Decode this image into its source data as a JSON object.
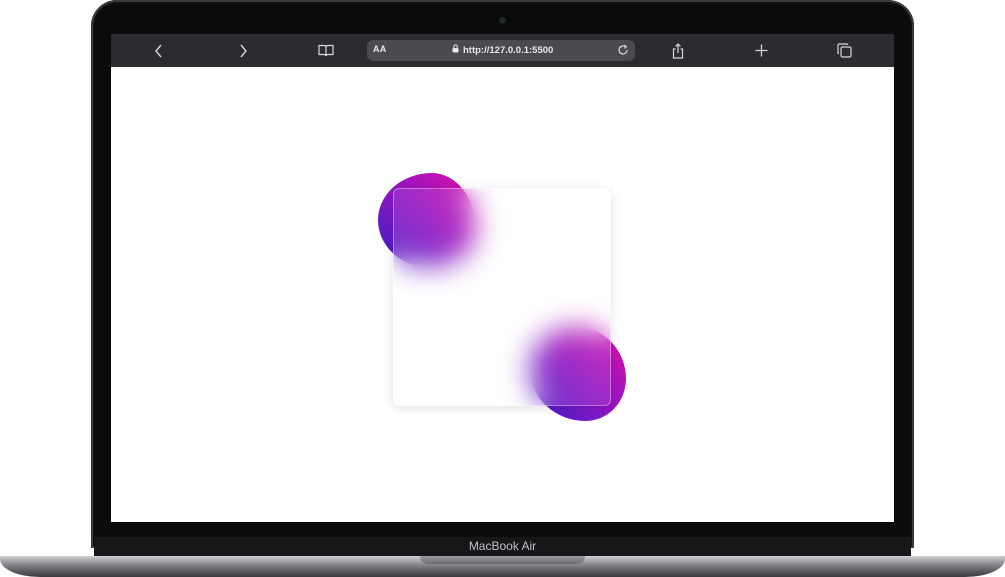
{
  "browser": {
    "text_size_label": "AA",
    "url": "http://127.0.0.1:5500"
  },
  "device": {
    "label": "MacBook Air"
  },
  "colors": {
    "toolbar": "#2b2c2f",
    "urlbar": "#4a4b4f",
    "blob_start": "#3a1fc0",
    "blob_end": "#e10fa9"
  },
  "icons": [
    "back-icon",
    "forward-icon",
    "bookmarks-icon",
    "lock-icon",
    "reload-icon",
    "share-icon",
    "new-tab-icon",
    "tabs-icon"
  ]
}
